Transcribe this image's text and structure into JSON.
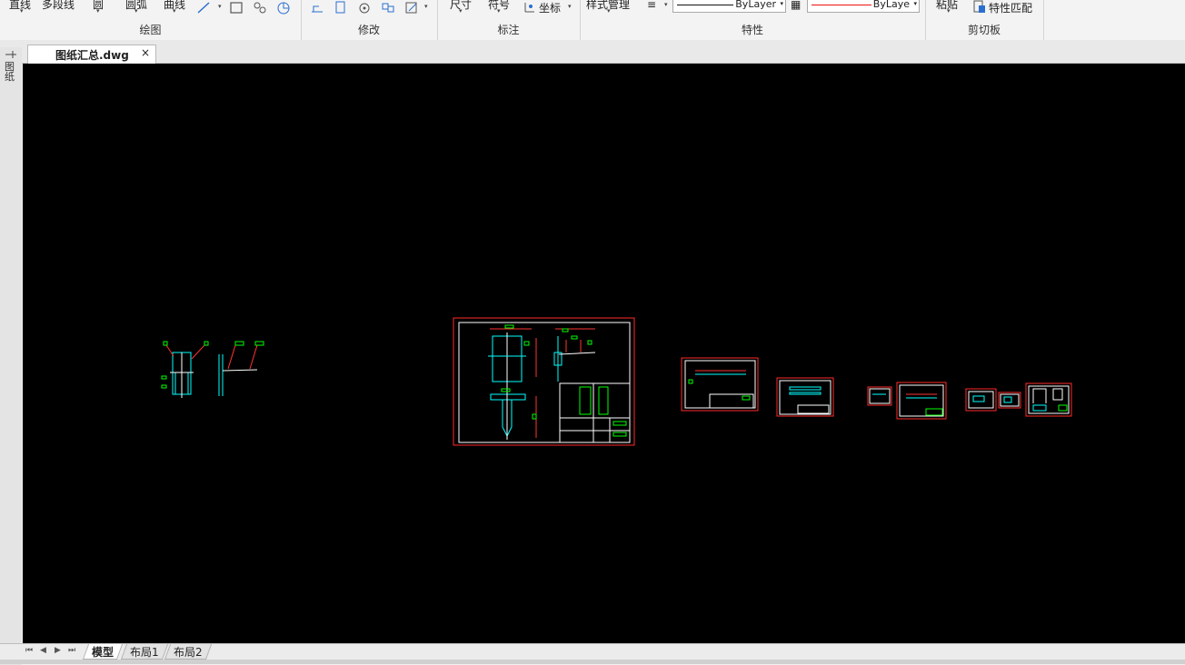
{
  "ribbon": {
    "draw_group": {
      "label": "绘图",
      "tools": [
        "直线",
        "多段线",
        "圆",
        "圆弧",
        "曲线"
      ]
    },
    "modify_group": {
      "label": "修改"
    },
    "annotation_group": {
      "label": "标注",
      "tools": [
        "尺寸",
        "符号",
        "坐标"
      ]
    },
    "properties_group": {
      "label": "特性",
      "style_manager": "样式管理",
      "linetype_value": "ByLayer",
      "color_value": "ByLaye"
    },
    "clipboard_group": {
      "label": "剪切板",
      "paste": "粘贴",
      "match_properties": "特性匹配"
    }
  },
  "document_tab": {
    "name": "图纸汇总.dwg",
    "close": "×"
  },
  "side_panel": {
    "label": "图纸"
  },
  "layout_tabs": [
    "模型",
    "布局1",
    "布局2"
  ],
  "nav_buttons": [
    "⏮",
    "◀",
    "▶",
    "⏭"
  ],
  "colors": {
    "canvas": "#000000",
    "frame": "#ff2a2a",
    "paper_border": "#ffffff",
    "geometry": "#00ffff",
    "dimension": "#00ff00"
  }
}
